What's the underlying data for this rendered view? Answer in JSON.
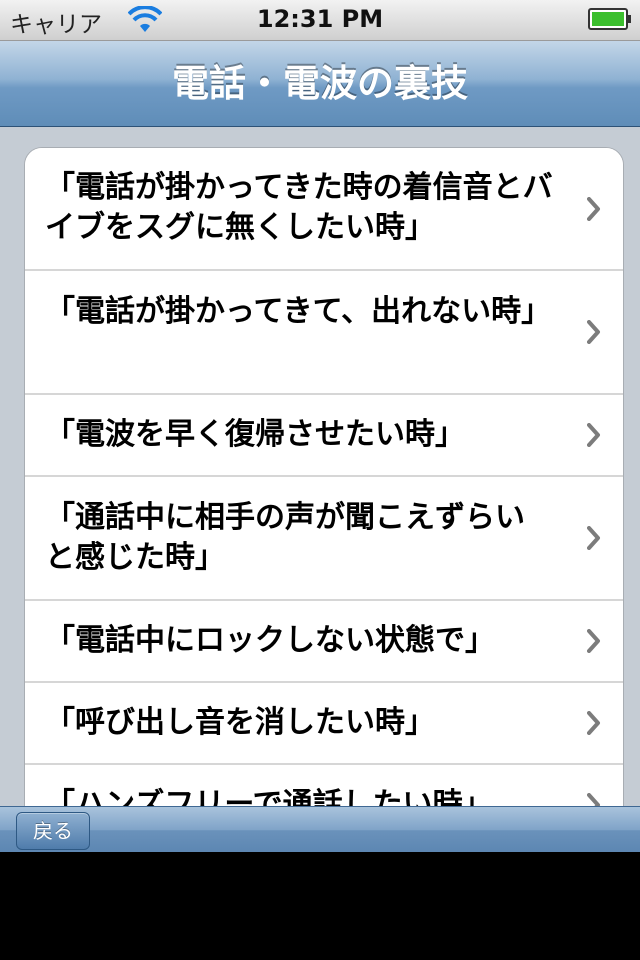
{
  "status_bar": {
    "carrier": "キャリア",
    "time": "12:31 PM",
    "wifi_icon": "wifi-icon",
    "battery_icon": "battery-icon",
    "battery_color": "#3cbf2e"
  },
  "nav_bar": {
    "title": "電話・電波の裏技"
  },
  "list": {
    "items": [
      {
        "label": "「電話が掛かってきた時の着信音とバイブをスグに無くしたい時」"
      },
      {
        "label": "「電話が掛かってきて、出れない時」"
      },
      {
        "label": "「電波を早く復帰させたい時」"
      },
      {
        "label": "「通話中に相手の声が聞こえずらいと感じた時」"
      },
      {
        "label": "「電話中にロックしない状態で」"
      },
      {
        "label": "「呼び出し音を消したい時」"
      },
      {
        "label": "「ハンズフリーで通話したい時」"
      }
    ],
    "chevron_icon": "chevron-right-icon"
  },
  "toolbar": {
    "back_label": "戻る"
  },
  "colors": {
    "nav_blue": "#6f9ac4",
    "background": "#c5ccd4"
  }
}
